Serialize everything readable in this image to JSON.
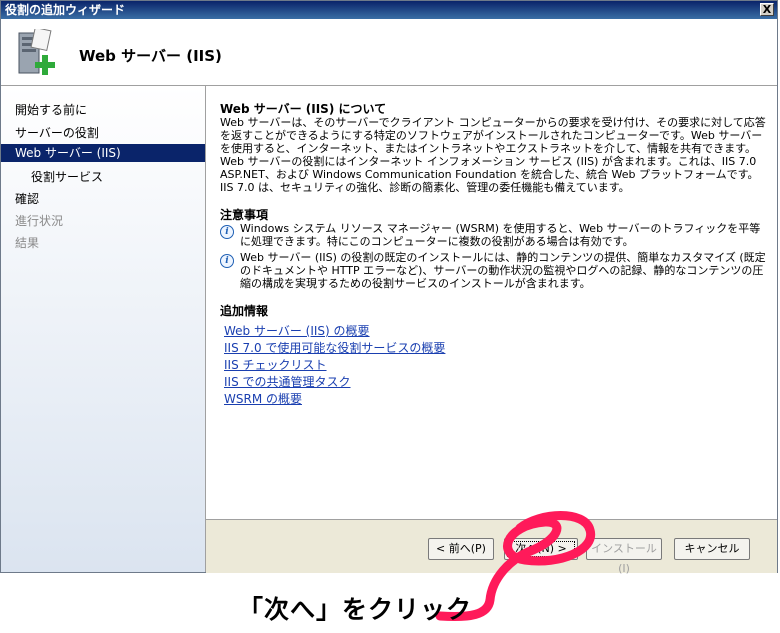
{
  "window": {
    "title": "役割の追加ウィザード",
    "close_label": "X"
  },
  "header": {
    "title": "Web サーバー (IIS)",
    "icon": "server-add-icon"
  },
  "sidebar": {
    "items": [
      {
        "label": "開始する前に",
        "state": "normal"
      },
      {
        "label": "サーバーの役割",
        "state": "normal"
      },
      {
        "label": "Web サーバー (IIS)",
        "state": "selected"
      },
      {
        "label": "役割サービス",
        "state": "normal"
      },
      {
        "label": "確認",
        "state": "normal"
      },
      {
        "label": "進行状況",
        "state": "disabled"
      },
      {
        "label": "結果",
        "state": "disabled"
      }
    ]
  },
  "main": {
    "about_heading": "Web サーバー (IIS) について",
    "about_text": "Web サーバーは、そのサーバーでクライアント コンピューターからの要求を受け付け、その要求に対して応答を返すことができるようにする特定のソフトウェアがインストールされたコンピューターです。Web サーバーを使用すると、インターネット、またはイントラネットやエクストラネットを介して、情報を共有できます。Web サーバーの役割にはインターネット インフォメーション サービス (IIS) が含まれます。これは、IIS 7.0 ASP.NET、および Windows Communication Foundation を統合した、統合 Web プラットフォームです。IIS 7.0 は、セキュリティの強化、診断の簡素化、管理の委任機能も備えています。",
    "notes_heading": "注意事項",
    "notes": [
      "Windows システム リソース マネージャー (WSRM) を使用すると、Web サーバーのトラフィックを平等に処理できます。特にこのコンピューターに複数の役割がある場合は有効です。",
      "Web サーバー (IIS) の役割の既定のインストールには、静的コンテンツの提供、簡単なカスタマイズ (既定のドキュメントや HTTP エラーなど)、サーバーの動作状況の監視やログへの記録、静的なコンテンツの圧縮の構成を実現するための役割サービスのインストールが含まれます。"
    ],
    "info_icon_glyph": "i",
    "more_heading": "追加情報",
    "links": [
      "Web サーバー (IIS) の概要",
      "IIS 7.0 で使用可能な役割サービスの概要",
      "IIS チェックリスト",
      "IIS での共通管理タスク",
      "WSRM の概要"
    ]
  },
  "footer": {
    "back_label": "< 前へ(P)",
    "next_label": "次へ(N) >",
    "install_label": "インストール(I)",
    "cancel_label": "キャンセル"
  },
  "annotation": {
    "caption": "「次へ」をクリック",
    "color": "#ff1a5a"
  }
}
